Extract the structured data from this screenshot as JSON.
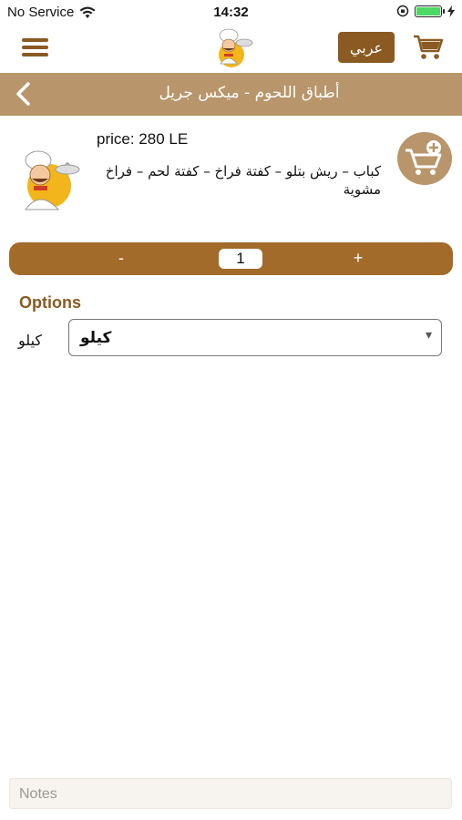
{
  "status_bar": {
    "carrier": "No Service",
    "time": "14:32",
    "battery_level": 1.0
  },
  "header": {
    "language_button": "عربي"
  },
  "title_bar": {
    "title": "أطباق اللحوم - ميكس جريل"
  },
  "product": {
    "price": "price: 280 LE",
    "description": "كباب – ريش بتلو – كفتة فراخ – كفتة لحم – فراخ مشوية"
  },
  "quantity": {
    "minus_label": "-",
    "value": "1",
    "plus_label": "+"
  },
  "options": {
    "title": "Options",
    "label": "كيلو",
    "selected": "كيلو",
    "arrow": "▾"
  },
  "notes": {
    "placeholder": "Notes"
  },
  "colors": {
    "brand_dark": "#8a5a22",
    "brand_light": "#b8956a",
    "qty_bar": "#a26b2a"
  },
  "icons": [
    "wifi-icon",
    "menu-icon",
    "chef-logo",
    "cart-icon",
    "back-icon",
    "add-to-cart-icon",
    "orientation-lock-icon",
    "battery-icon"
  ]
}
